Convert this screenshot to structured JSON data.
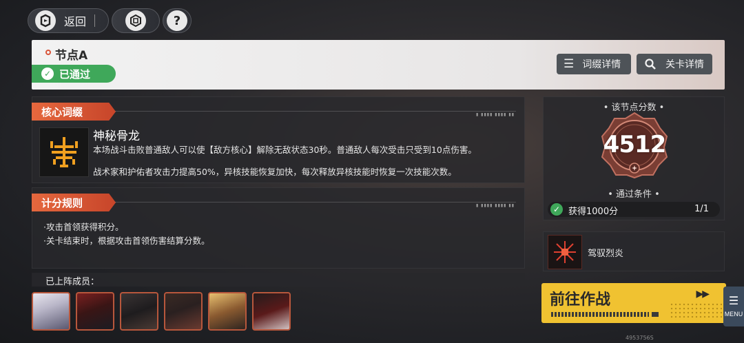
{
  "topbar": {
    "back_label": "返回",
    "help_symbol": "?"
  },
  "header": {
    "node_name": "节点A",
    "status": "已通过",
    "affix_detail_label": "词缀详情",
    "stage_detail_label": "关卡详情"
  },
  "core_affix": {
    "section_label": "核心词缀",
    "name": "神秘骨龙",
    "desc1": "本场战斗击败普通敌人可以使【敌方核心】解除无敌状态30秒。普通敌人每次受击只受到10点伤害。",
    "desc2": "战术家和护佑者攻击力提高50%，异核技能恢复加快，每次释放异核技能时恢复一次技能次数。"
  },
  "scoring": {
    "section_label": "计分规则",
    "rules": [
      "·攻击首领获得积分。",
      "·关卡结束时，根据攻击首领伤害结算分数。"
    ]
  },
  "members": {
    "label": "已上阵成员："
  },
  "score": {
    "title": "• 该节点分数 •",
    "value": "4512",
    "pass_title": "• 通过条件 •",
    "condition": "获得1000分",
    "progress": "1/1"
  },
  "skill": {
    "name": "驾驭烈炎"
  },
  "go": {
    "label": "前往作战"
  },
  "menu": {
    "label": "MENU"
  },
  "footer": {
    "uid": "4953756S"
  },
  "colors": {
    "accent_orange": "#d9553a",
    "pass_green": "#3fa85a",
    "go_yellow": "#f0c231"
  }
}
